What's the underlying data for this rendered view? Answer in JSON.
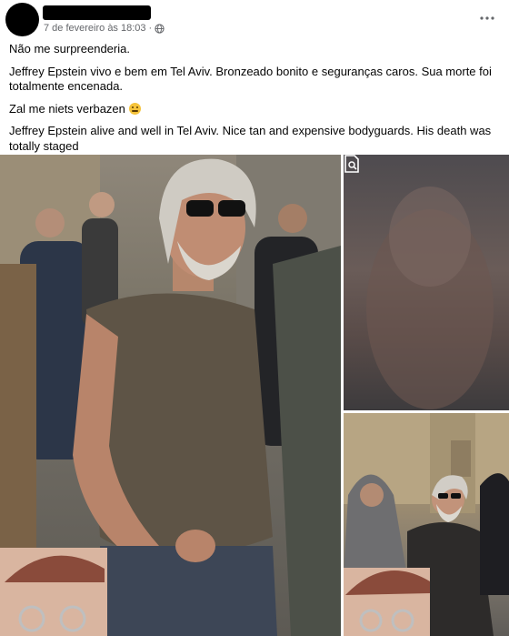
{
  "post": {
    "timestamp": "7 de fevereiro às 18:03",
    "separator": "·",
    "audience_icon": "globe-icon",
    "more_icon": "more-icon"
  },
  "text": {
    "line1": "Não me surpreenderia.",
    "line2": "Jeffrey Epstein vivo e bem em Tel Aviv. Bronzeado bonito e seguranças caros. Sua morte foi totalmente encenada.",
    "line3": "Zal me niets verbazen",
    "line3_emoji": "grimacing-face-emoji",
    "line4": "Jeffrey Epstein alive and well in Tel Aviv. Nice tan and expensive bodyguards. His death was totally staged"
  },
  "gallery": {
    "photos": [
      {
        "name": "main-photo",
        "depicts": "grey-haired bearded man in sunglasses on street"
      },
      {
        "name": "blurred-photo",
        "depicts": "blurred image",
        "overlay_icon": "sensitive-content-icon"
      },
      {
        "name": "street-photo",
        "depicts": "man in dark jacket walking with hooded men"
      }
    ]
  },
  "colors": {
    "text": "#050505",
    "meta": "#65676b",
    "background": "#ffffff"
  }
}
